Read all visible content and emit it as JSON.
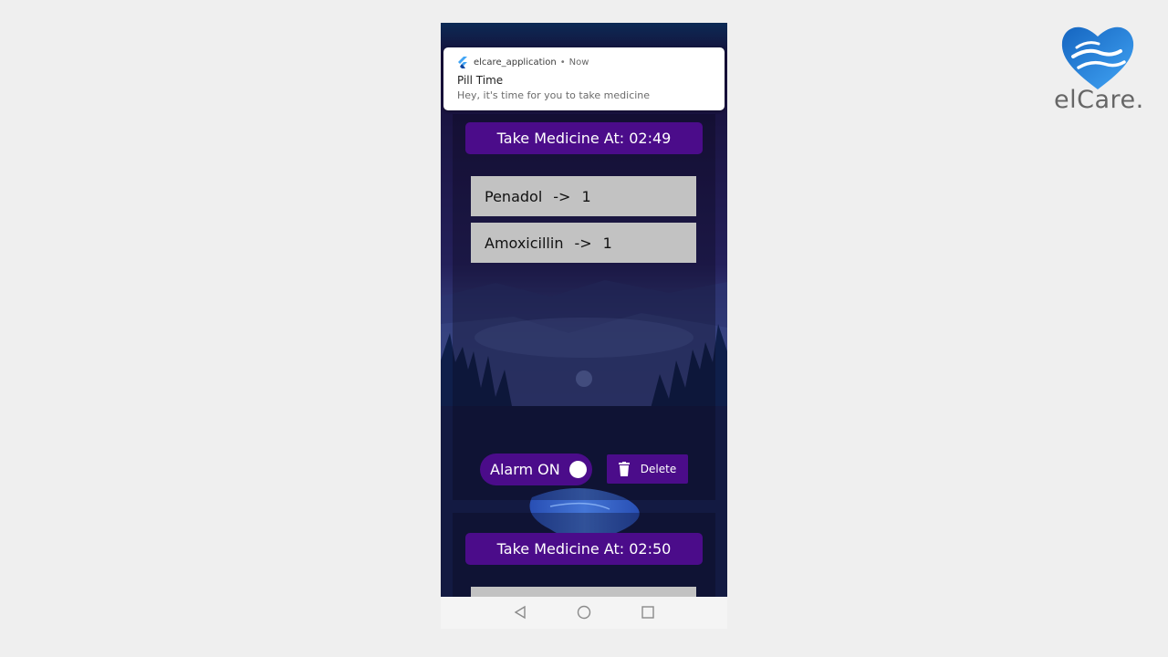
{
  "notification": {
    "app_name": "elcare_application",
    "separator": "•",
    "time": "Now",
    "title": "Pill Time",
    "body": "Hey, it's time for you to take medicine"
  },
  "schedules": [
    {
      "header": "Take Medicine At: 02:49",
      "medicines": [
        {
          "name": "Penadol",
          "arrow": "->",
          "qty": "1"
        },
        {
          "name": "Amoxicillin",
          "arrow": "->",
          "qty": "1"
        }
      ],
      "alarm_label": "Alarm ON",
      "alarm_on": true,
      "delete_label": "Delete"
    },
    {
      "header": "Take Medicine At: 02:50"
    }
  ],
  "navbar": {
    "back_icon": "back-triangle-icon",
    "home_icon": "home-circle-icon",
    "recents_icon": "recents-square-icon"
  },
  "brand": {
    "logo_text": "elCare.",
    "accent": "#4b0c8a",
    "logo_blue": "#1e88e5"
  }
}
